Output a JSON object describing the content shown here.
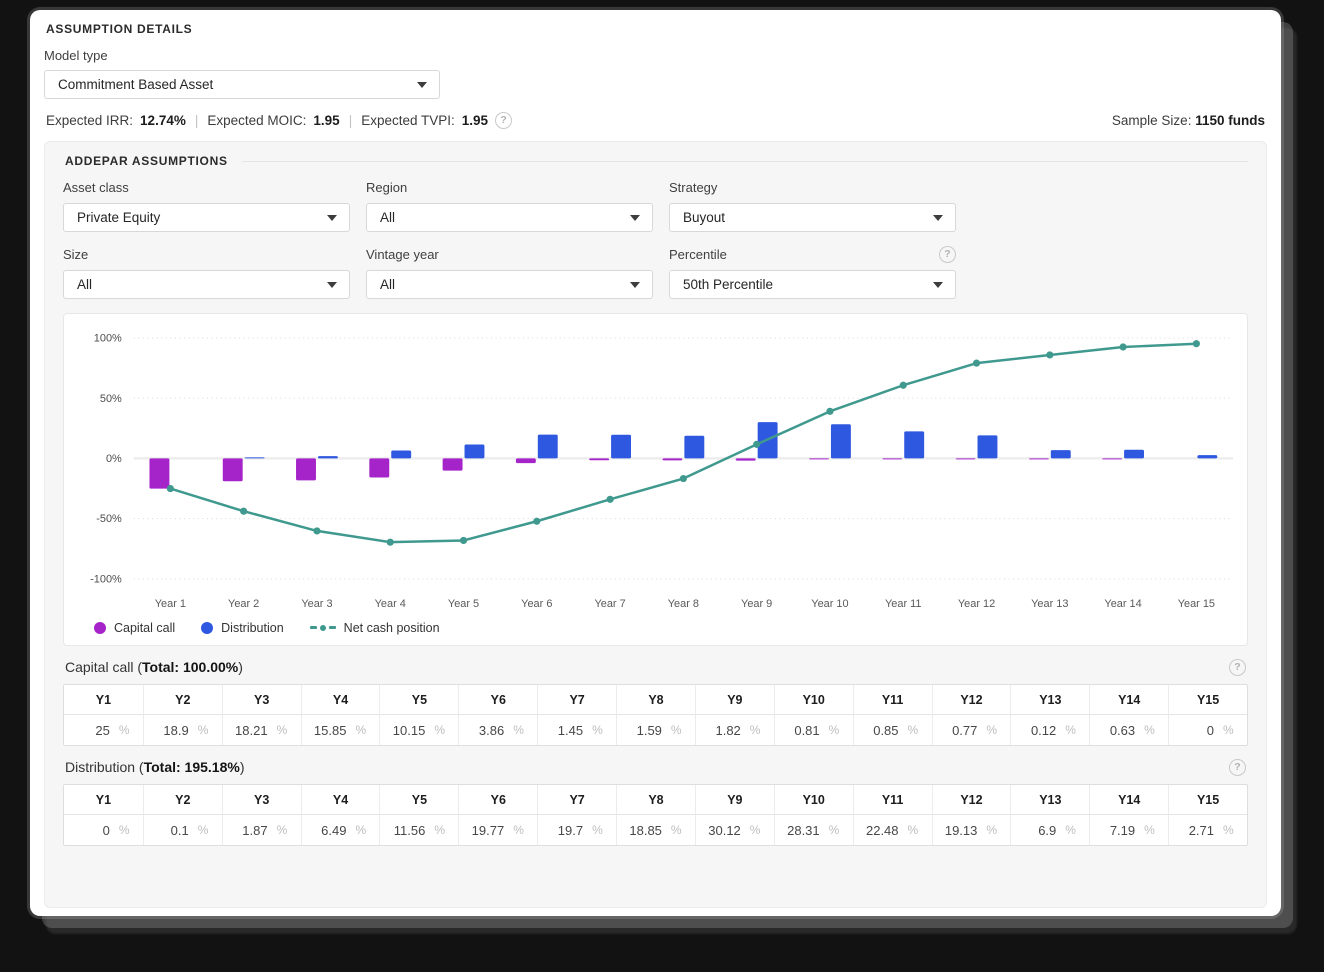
{
  "header": {
    "section_title": "Assumption details",
    "model_type_label": "Model type",
    "model_type_value": "Commitment Based Asset",
    "stats": {
      "irr_label": "Expected IRR:",
      "irr_value": "12.74%",
      "moic_label": "Expected MOIC:",
      "moic_value": "1.95",
      "tvpi_label": "Expected TVPI:",
      "tvpi_value": "1.95",
      "divider": "|",
      "sample_size_label": "Sample Size:",
      "sample_size_value": "1150 funds"
    }
  },
  "assumptions": {
    "section_title": "Addepar assumptions",
    "filters": [
      {
        "label": "Asset class",
        "value": "Private Equity"
      },
      {
        "label": "Region",
        "value": "All"
      },
      {
        "label": "Strategy",
        "value": "Buyout"
      },
      {
        "label": "Size",
        "value": "All"
      },
      {
        "label": "Vintage year",
        "value": "All"
      },
      {
        "label": "Percentile",
        "value": "50th Percentile",
        "has_help": true
      }
    ]
  },
  "chart_data": {
    "type": "bar",
    "subtype": "grouped bars with overlay line",
    "categories": [
      "Year 1",
      "Year 2",
      "Year 3",
      "Year 4",
      "Year 5",
      "Year 6",
      "Year 7",
      "Year 8",
      "Year 9",
      "Year 10",
      "Year 11",
      "Year 12",
      "Year 13",
      "Year 14",
      "Year 15"
    ],
    "series": [
      {
        "name": "Capital call",
        "type": "bar",
        "color": "#a524c9",
        "values": [
          -25,
          -18.9,
          -18.21,
          -15.85,
          -10.15,
          -3.86,
          -1.45,
          -1.59,
          -1.82,
          -0.81,
          -0.85,
          -0.77,
          -0.12,
          -0.63,
          0
        ]
      },
      {
        "name": "Distribution",
        "type": "bar",
        "color": "#2f58e0",
        "values": [
          0,
          0.1,
          1.87,
          6.49,
          11.56,
          19.77,
          19.7,
          18.85,
          30.12,
          28.31,
          22.48,
          19.13,
          6.9,
          7.19,
          2.71
        ]
      },
      {
        "name": "Net cash position",
        "type": "line",
        "color": "#3f998e",
        "values": [
          -25,
          -43.8,
          -60.14,
          -69.5,
          -68.09,
          -52.18,
          -33.93,
          -16.67,
          11.63,
          39.13,
          60.76,
          79.12,
          85.9,
          92.46,
          95.17
        ]
      }
    ],
    "ylim": [
      -100,
      100
    ],
    "yticks": [
      {
        "value": 100,
        "label": "100%"
      },
      {
        "value": 50,
        "label": "50%"
      },
      {
        "value": 0,
        "label": "0%"
      },
      {
        "value": -50,
        "label": "-50%"
      },
      {
        "value": -100,
        "label": "-100%"
      }
    ],
    "grid": "dotted horizontal",
    "legend_position": "bottom-left"
  },
  "tables": {
    "capital_call": {
      "title_prefix": "Capital call (",
      "title_total": "Total: 100.00%",
      "title_suffix": ")",
      "unit": "%",
      "columns": [
        "Y1",
        "Y2",
        "Y3",
        "Y4",
        "Y5",
        "Y6",
        "Y7",
        "Y8",
        "Y9",
        "Y10",
        "Y11",
        "Y12",
        "Y13",
        "Y14",
        "Y15"
      ],
      "values": [
        "25",
        "18.9",
        "18.21",
        "15.85",
        "10.15",
        "3.86",
        "1.45",
        "1.59",
        "1.82",
        "0.81",
        "0.85",
        "0.77",
        "0.12",
        "0.63",
        "0"
      ]
    },
    "distribution": {
      "title_prefix": "Distribution (",
      "title_total": "Total: 195.18%",
      "title_suffix": ")",
      "unit": "%",
      "columns": [
        "Y1",
        "Y2",
        "Y3",
        "Y4",
        "Y5",
        "Y6",
        "Y7",
        "Y8",
        "Y9",
        "Y10",
        "Y11",
        "Y12",
        "Y13",
        "Y14",
        "Y15"
      ],
      "values": [
        "0",
        "0.1",
        "1.87",
        "6.49",
        "11.56",
        "19.77",
        "19.7",
        "18.85",
        "30.12",
        "28.31",
        "22.48",
        "19.13",
        "6.9",
        "7.19",
        "2.71"
      ]
    }
  },
  "icons": {
    "help": "?"
  },
  "colors": {
    "capital_call": "#a524c9",
    "distribution": "#2f58e0",
    "net_cash": "#3f998e",
    "panel_bg": "#f6f6f7",
    "card_bg": "#ffffff",
    "page_bg": "#121212"
  }
}
